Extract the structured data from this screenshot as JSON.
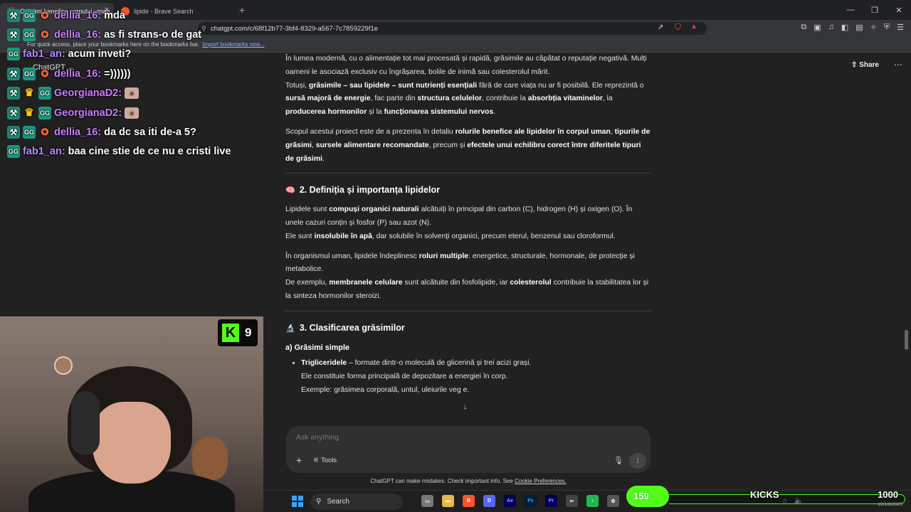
{
  "browser": {
    "tabs": [
      {
        "label": "Grăsimi benefice corpului uman...",
        "active": true
      },
      {
        "label": "lipide - Brave Search",
        "active": false
      }
    ],
    "new_tab": "+",
    "url": "chatgpt.com/c/68f12b77-3bf4-8329-a567-7c7859229f1e",
    "bookmarks_hint": "For quick access, place your bookmarks here on the bookmarks bar.",
    "bookmarks_link": "Import bookmarks now..."
  },
  "gpt": {
    "model": "ChatGPT",
    "share_label": "Share",
    "composer_placeholder": "Ask anything",
    "tools_label": "Tools",
    "disclaimer": "ChatGPT can make mistakes. Check important info. See",
    "disclaimer_link": "Cookie Preferences."
  },
  "article": {
    "intro_p1": "În lumea modernă, cu o alimentație tot mai procesată și rapidă, grăsimile au căpătat o reputație negativă. Mulți oameni le asociază exclusiv cu îngrășarea, bolile de inimă sau colesterolul mărit.",
    "intro_p2_a": "Totuși, ",
    "intro_p2_b": "grăsimile – sau lipidele – sunt nutrienți esențiali",
    "intro_p2_c": " fără de care viața nu ar fi posibilă. Ele reprezintă o ",
    "intro_p2_d": "sursă majoră de energie",
    "intro_p2_e": ", fac parte din ",
    "intro_p2_f": "structura celulelor",
    "intro_p2_g": ", contribuie la ",
    "intro_p2_h": "absorbția vitaminelor",
    "intro_p2_i": ", la ",
    "intro_p2_j": "producerea hormonilor",
    "intro_p2_k": " și la ",
    "intro_p2_l": "funcționarea sistemului nervos",
    "intro_p2_m": ".",
    "scope_a": "Scopul acestui proiect este de a prezenta în detaliu ",
    "scope_b": "rolurile benefice ale lipidelor în corpul uman",
    "scope_c": ", ",
    "scope_d": "tipurile de grăsimi",
    "scope_e": ", ",
    "scope_f": "sursele alimentare recomandate",
    "scope_g": ", precum și ",
    "scope_h": "efectele unui echilibru corect între diferitele tipuri de grăsimi",
    "scope_i": ".",
    "h2": "2. Definiția și importanța lipidelor",
    "def_a": "Lipidele sunt ",
    "def_b": "compuși organici naturali",
    "def_c": " alcătuiți în principal din carbon (C), hidrogen (H) și oxigen (O). În unele cazuri conțin și fosfor (P) sau azot (N).",
    "def_d": "Ele sunt ",
    "def_e": "insolubile în apă",
    "def_f": ", dar solubile în solvenți organici, precum eterul, benzenul sau cloroformul.",
    "roles_a": "În organismul uman, lipidele îndeplinesc ",
    "roles_b": "roluri multiple",
    "roles_c": ": energetice, structurale, hormonale, de protecție și metabolice.",
    "ex_a": "De exemplu, ",
    "ex_b": "membranele celulare",
    "ex_c": " sunt alcătuite din fosfolipide, iar ",
    "ex_d": "colesterolul",
    "ex_e": " contribuie la stabilitatea lor și la sinteza hormonilor steroizi.",
    "h3": "3. Clasificarea grăsimilor",
    "h3a": "a) Grăsimi simple",
    "li_a": "Trigliceridele",
    "li_b": " – formate dintr-o moleculă de glicerină și trei acizi grași.",
    "li_c": "Ele constituie forma principală de depozitare a energiei în corp.",
    "li_d": "Exemple: grăsimea corporală, untul, uleiurile veg",
    "li_e": "e."
  },
  "chat": [
    {
      "user": "dellia_16",
      "color": "#c77dff",
      "msg": "mda",
      "badges": [
        "tool",
        "gg",
        "bolt"
      ]
    },
    {
      "user": "dellia_16",
      "color": "#c77dff",
      "msg": "as fi strans-o de gat",
      "badges": [
        "tool",
        "gg",
        "bolt"
      ]
    },
    {
      "user": "fab1_an",
      "color": "#b388ff",
      "msg": "acum inveti?",
      "badges": [
        "gg"
      ]
    },
    {
      "user": "dellia_16",
      "color": "#c77dff",
      "msg": "=))))))",
      "badges": [
        "tool",
        "gg",
        "bolt"
      ]
    },
    {
      "user": "GeorgianaD2",
      "color": "#c77dff",
      "msg": "",
      "badges": [
        "tool",
        "crown",
        "gg"
      ],
      "emote": true
    },
    {
      "user": "GeorgianaD2",
      "color": "#c77dff",
      "msg": "",
      "badges": [
        "tool",
        "crown",
        "gg"
      ],
      "emote": true
    },
    {
      "user": "dellia_16",
      "color": "#c77dff",
      "msg": "da dc sa iti de-a 5?",
      "badges": [
        "tool",
        "gg",
        "bolt"
      ]
    },
    {
      "user": "fab1_an",
      "color": "#b388ff",
      "msg": "baa cine stie de ce nu e cristi live",
      "badges": [
        "gg"
      ]
    }
  ],
  "stream": {
    "viewer_count": "9",
    "sub_count": "159",
    "goal_label": "KICKS",
    "goal_target": "1000",
    "sub_progress": 0.159
  },
  "taskbar": {
    "search_label": "Search",
    "date": "10/16/2025"
  }
}
